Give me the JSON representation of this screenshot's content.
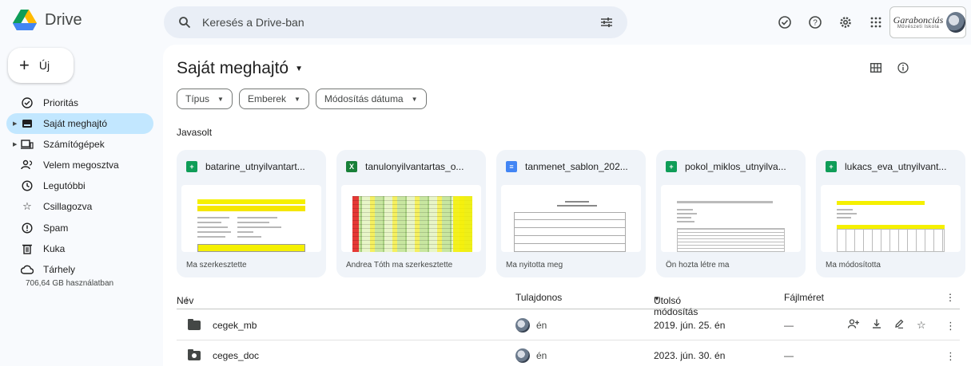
{
  "app": {
    "name": "Drive"
  },
  "search": {
    "placeholder": "Keresés a Drive-ban"
  },
  "org": {
    "name": "Garabonciás",
    "subtitle": "Művészeti Iskola"
  },
  "sidebar": {
    "new_label": "Új",
    "items": [
      {
        "label": "Prioritás",
        "icon": "check-circle-icon"
      },
      {
        "label": "Saját meghajtó",
        "icon": "drive-icon",
        "active": true
      },
      {
        "label": "Számítógépek",
        "icon": "computer-icon"
      },
      {
        "label": "Velem megosztva",
        "icon": "people-icon"
      },
      {
        "label": "Legutóbbi",
        "icon": "clock-icon"
      },
      {
        "label": "Csillagozva",
        "icon": "star-icon"
      },
      {
        "label": "Spam",
        "icon": "spam-icon"
      },
      {
        "label": "Kuka",
        "icon": "trash-icon"
      },
      {
        "label": "Tárhely",
        "icon": "cloud-icon"
      }
    ],
    "storage": "706,64 GB használatban"
  },
  "main": {
    "title": "Saját meghajtó",
    "filters": [
      "Típus",
      "Emberek",
      "Módosítás dátuma"
    ],
    "suggested_label": "Javasolt",
    "cards": [
      {
        "name": "batarine_utnyilvantart...",
        "type": "sheet",
        "footer": "Ma szerkesztette"
      },
      {
        "name": "tanulonyilvantartas_o...",
        "type": "excel",
        "footer": "Andrea Tóth ma szerkesztette"
      },
      {
        "name": "tanmenet_sablon_202...",
        "type": "doc",
        "footer": "Ma nyitotta meg"
      },
      {
        "name": "pokol_miklos_utnyilva...",
        "type": "sheet",
        "footer": "Ön hozta létre ma"
      },
      {
        "name": "lukacs_eva_utnyilvant...",
        "type": "sheet",
        "footer": "Ma módosította"
      }
    ],
    "table": {
      "headers": {
        "name": "Név",
        "owner": "Tulajdonos",
        "modified": "Utolsó módosítás",
        "size": "Fájlméret"
      },
      "rows": [
        {
          "name": "cegek_mb",
          "owner": "én",
          "modified": "2019. jún. 25. én",
          "size": "—",
          "shared": false
        },
        {
          "name": "ceges_doc",
          "owner": "én",
          "modified": "2023. jún. 30. én",
          "size": "—",
          "shared": true
        }
      ]
    }
  },
  "colors": {
    "accent": "#c2e7ff",
    "search_bg": "#e9eef6",
    "page_bg": "#f8fafd",
    "sheet": "#0f9d58",
    "doc": "#4285f4"
  }
}
